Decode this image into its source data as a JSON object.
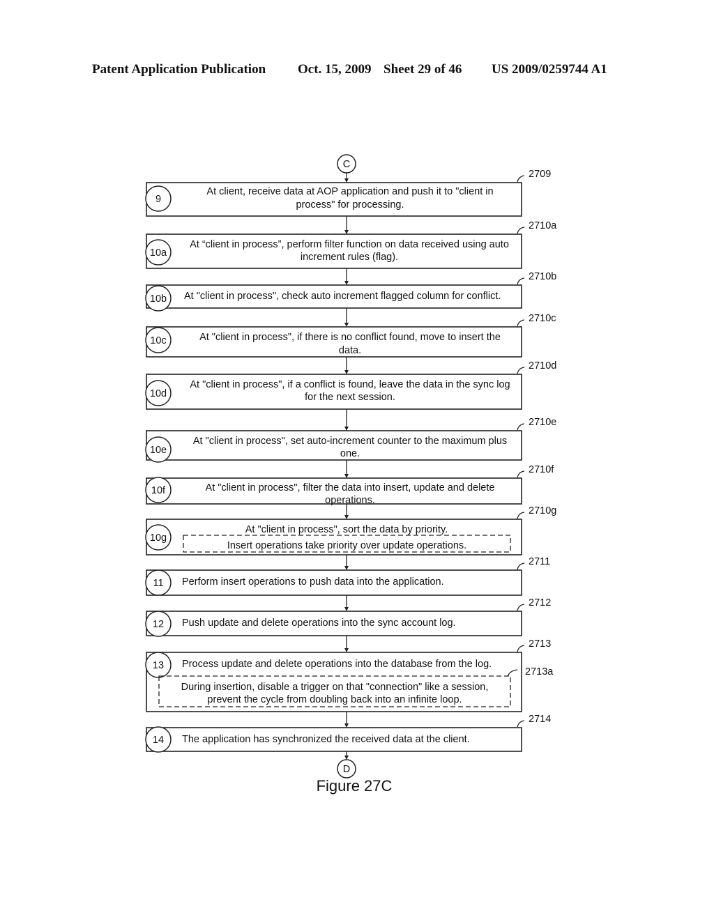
{
  "header": {
    "publication": "Patent Application Publication",
    "date": "Oct. 15, 2009",
    "sheet": "Sheet 29 of 46",
    "number": "US 2009/0259744 A1"
  },
  "connectors": {
    "start": "C",
    "end": "D"
  },
  "steps": [
    {
      "id": "9",
      "ref": "2709",
      "lines": [
        "At client, receive data at AOP application and push it to \"client in",
        "process\" for processing."
      ]
    },
    {
      "id": "10a",
      "ref": "2710a",
      "lines": [
        "At “client in process”, perform filter function on data received using auto",
        "increment rules (flag)."
      ]
    },
    {
      "id": "10b",
      "ref": "2710b",
      "lines": [
        "At \"client in process\", check auto increment flagged column for conflict."
      ]
    },
    {
      "id": "10c",
      "ref": "2710c",
      "lines": [
        "At \"client in process\", if there is no conflict found, move to insert the",
        "data."
      ]
    },
    {
      "id": "10d",
      "ref": "2710d",
      "lines": [
        "At \"client in process\", if a conflict is found, leave the data in the sync log",
        "for the next session."
      ]
    },
    {
      "id": "10e",
      "ref": "2710e",
      "lines": [
        "At \"client in process\", set auto-increment counter to the maximum plus",
        "one."
      ]
    },
    {
      "id": "10f",
      "ref": "2710f",
      "lines": [
        "At \"client in process\", filter the data into insert, update and delete",
        "operations."
      ]
    },
    {
      "id": "10g",
      "ref": "2710g",
      "lines": [
        "At \"client in process\", sort the data by priority."
      ],
      "sub": {
        "lines": [
          "Insert operations take priority over update operations."
        ]
      }
    },
    {
      "id": "11",
      "ref": "2711",
      "lines": [
        "Perform insert operations to push data into the application."
      ]
    },
    {
      "id": "12",
      "ref": "2712",
      "lines": [
        "Push update and delete operations into the sync account log."
      ]
    },
    {
      "id": "13",
      "ref": "2713",
      "lines": [
        "Process update and delete operations into the database from the log."
      ],
      "sub": {
        "ref": "2713a",
        "lines": [
          "During insertion, disable a trigger on that \"connection\" like a session,",
          "prevent the cycle from doubling back into an infinite loop."
        ]
      }
    },
    {
      "id": "14",
      "ref": "2714",
      "lines": [
        "The application has synchronized the received data at the client."
      ]
    }
  ],
  "figure_caption": "Figure 27C"
}
